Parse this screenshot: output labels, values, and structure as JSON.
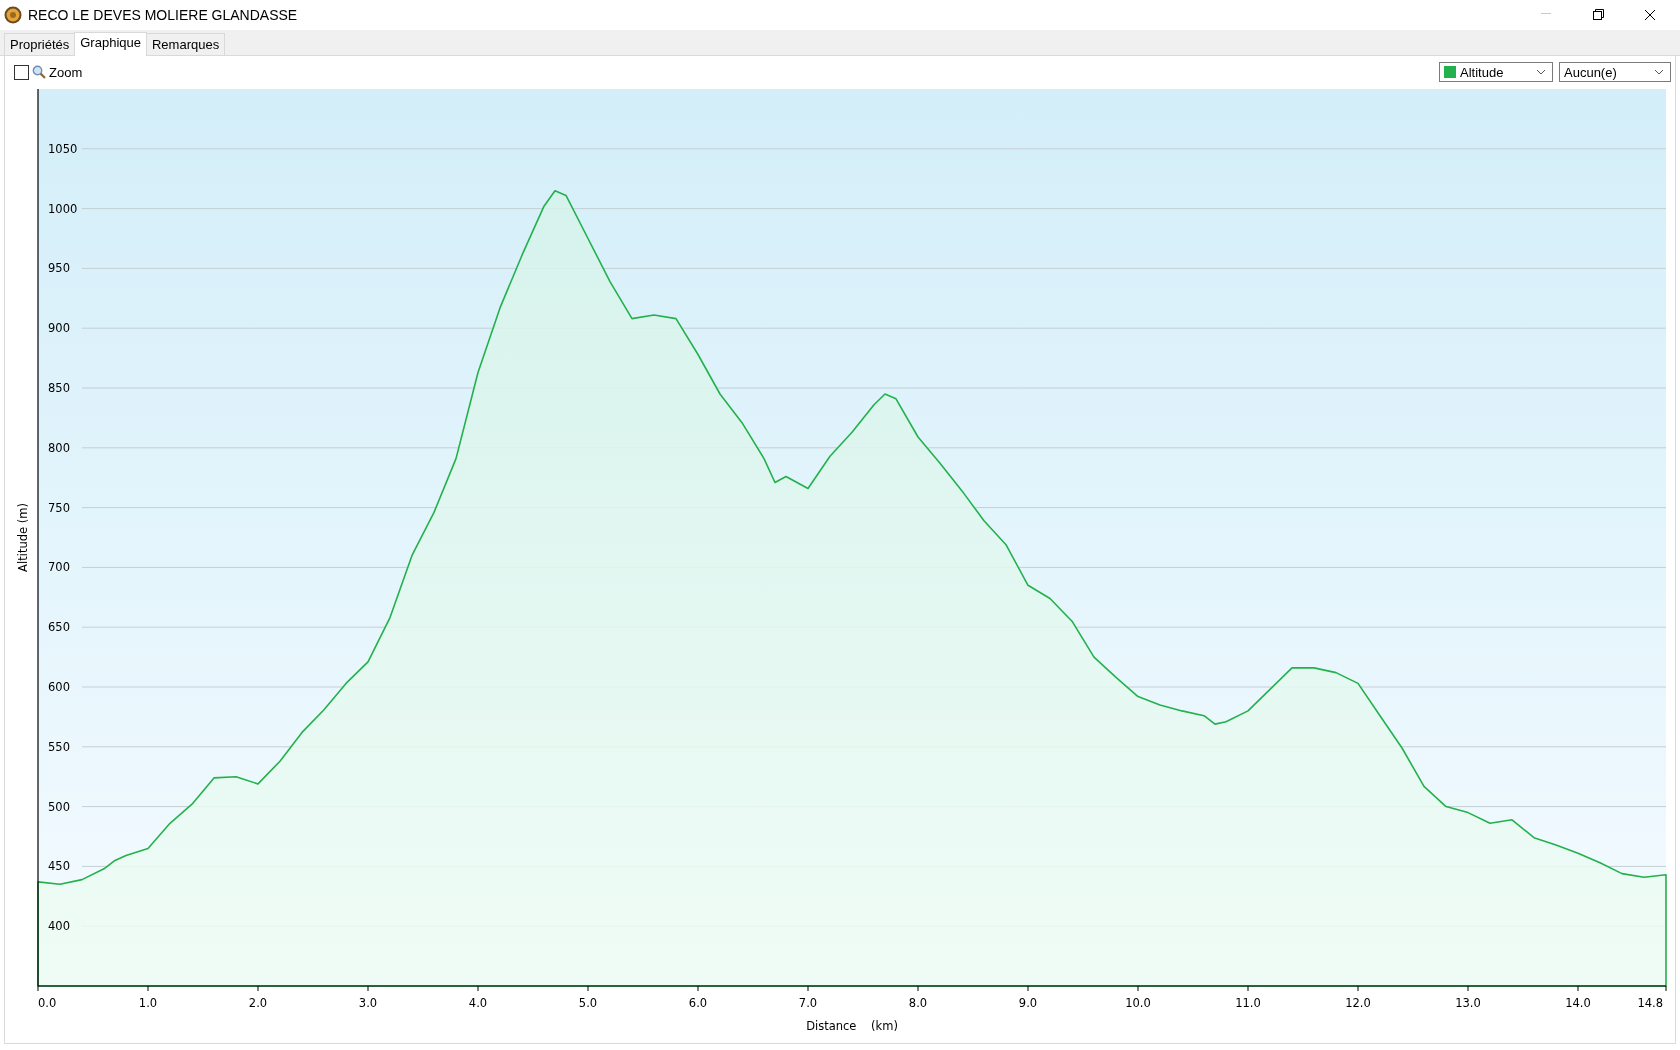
{
  "window": {
    "title": "RECO LE DEVES MOLIERE GLANDASSE"
  },
  "tabs": [
    {
      "label": "Propriétés",
      "selected": false
    },
    {
      "label": "Graphique",
      "selected": true
    },
    {
      "label": "Remarques",
      "selected": false
    }
  ],
  "toolbar": {
    "zoom": {
      "label": "Zoom",
      "checked": false
    },
    "dropdowns": [
      {
        "value": "Aucun(e)"
      }
    ]
  },
  "chart": {
    "chart_data": {
      "type": "area",
      "xlabel": "Distance    (km)",
      "ylabel": "Altitude (m)",
      "x": [
        0,
        0.2,
        0.4,
        0.6,
        0.7,
        0.8,
        1.0,
        1.2,
        1.4,
        1.6,
        1.8,
        2.0,
        2.2,
        2.4,
        2.6,
        2.8,
        3.0,
        3.2,
        3.4,
        3.6,
        3.8,
        4.0,
        4.2,
        4.4,
        4.6,
        4.7,
        4.8,
        5.0,
        5.2,
        5.4,
        5.6,
        5.8,
        6.0,
        6.2,
        6.4,
        6.6,
        6.7,
        6.8,
        7.0,
        7.2,
        7.4,
        7.6,
        7.7,
        7.8,
        8.0,
        8.2,
        8.4,
        8.6,
        8.8,
        9.0,
        9.2,
        9.4,
        9.6,
        9.8,
        10.0,
        10.2,
        10.4,
        10.6,
        10.7,
        10.8,
        11.0,
        11.2,
        11.4,
        11.6,
        11.8,
        12.0,
        12.2,
        12.4,
        12.6,
        12.8,
        13.0,
        13.2,
        13.4,
        13.6,
        13.8,
        14.0,
        14.2,
        14.4,
        14.6,
        14.8
      ],
      "series": [
        {
          "name": "Altitude",
          "color": "#22b14c",
          "values": [
            437,
            435,
            439,
            448,
            455,
            459,
            465,
            486,
            502,
            524,
            525,
            519,
            538,
            562,
            581,
            603,
            621,
            658,
            710,
            746,
            791,
            863,
            917,
            961,
            1002,
            1015,
            1011,
            975,
            939,
            908,
            911,
            908,
            878,
            845,
            821,
            791,
            771,
            776,
            766,
            793,
            813,
            836,
            845,
            841,
            809,
            787,
            764,
            739,
            719,
            685,
            674,
            655,
            625,
            608,
            592,
            585,
            580,
            576,
            569,
            571,
            580,
            598,
            616,
            616,
            612,
            603,
            576,
            549,
            517,
            500,
            495,
            486,
            489,
            474,
            468,
            461,
            453,
            444,
            441,
            443
          ]
        }
      ],
      "grid": true,
      "xlim": [
        0,
        14.8
      ],
      "ylim": [
        350,
        1100
      ],
      "xticks": [
        {
          "value": 0,
          "label": "0.0"
        },
        {
          "value": 1,
          "label": "1.0"
        },
        {
          "value": 2,
          "label": "2.0"
        },
        {
          "value": 3,
          "label": "3.0"
        },
        {
          "value": 4,
          "label": "4.0"
        },
        {
          "value": 5,
          "label": "5.0"
        },
        {
          "value": 6,
          "label": "6.0"
        },
        {
          "value": 7,
          "label": "7.0"
        },
        {
          "value": 8,
          "label": "8.0"
        },
        {
          "value": 9,
          "label": "9.0"
        },
        {
          "value": 10,
          "label": "10.0"
        },
        {
          "value": 11,
          "label": "11.0"
        },
        {
          "value": 12,
          "label": "12.0"
        },
        {
          "value": 13,
          "label": "13.0"
        },
        {
          "value": 14,
          "label": "14.0"
        },
        {
          "value": 14.8,
          "label": "14.8"
        }
      ],
      "yticks": [
        400,
        450,
        500,
        550,
        600,
        650,
        700,
        750,
        800,
        850,
        900,
        950,
        1000,
        1050
      ]
    }
  }
}
